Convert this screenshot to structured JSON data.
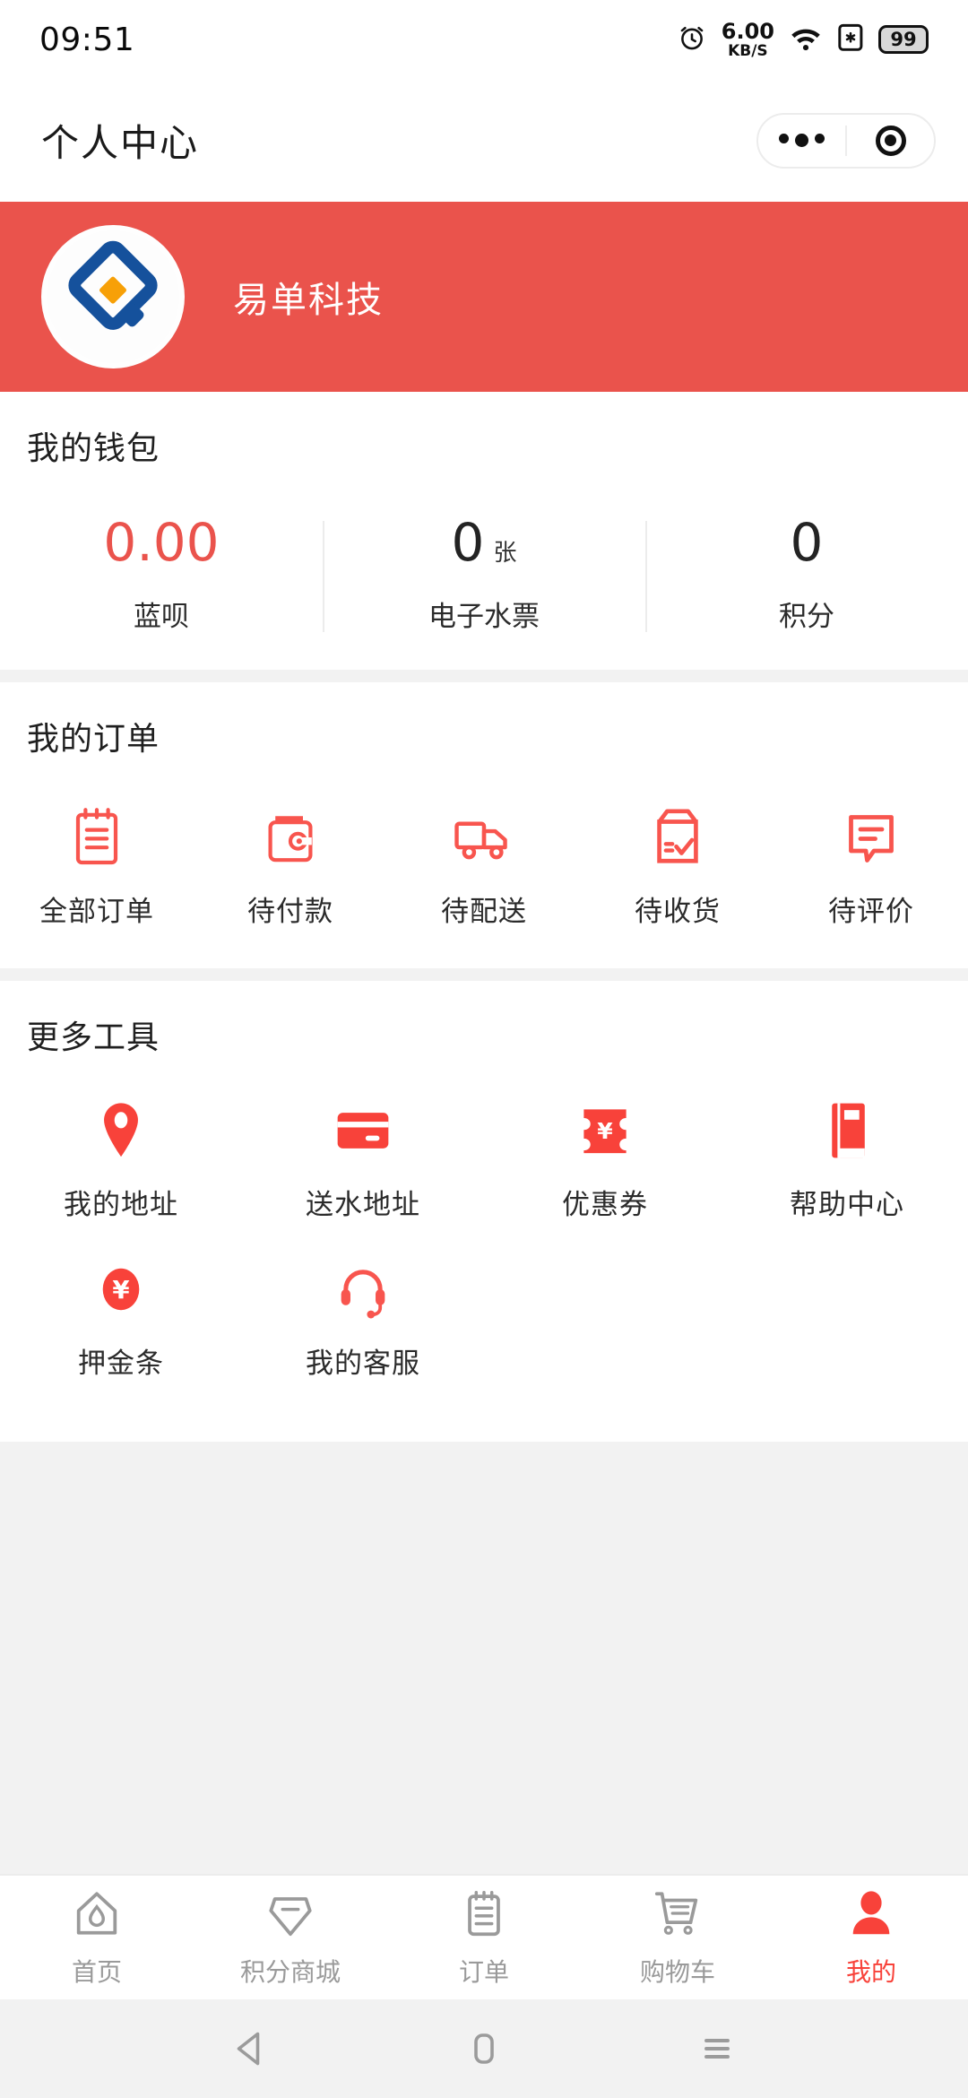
{
  "statusbar": {
    "time": "09:51",
    "net_speed_value": "6.00",
    "net_speed_unit": "KB/S",
    "battery": "99",
    "icons": [
      "alarm-icon",
      "wifi-icon",
      "sim-card-icon",
      "battery-icon"
    ]
  },
  "navbar": {
    "title": "个人中心",
    "capsule_menu_icon": "more-dots-icon",
    "capsule_close_icon": "target-circle-icon"
  },
  "profile": {
    "name": "易单科技",
    "avatar_icon": "company-logo-icon",
    "header_color": "#ea534c"
  },
  "wallet": {
    "title": "我的钱包",
    "items": [
      {
        "value": "0.00",
        "unit": "",
        "label": "蓝呗",
        "color": "#ea534c"
      },
      {
        "value": "0",
        "unit": "张",
        "label": "电子水票",
        "color": "#232323"
      },
      {
        "value": "0",
        "unit": "",
        "label": "积分",
        "color": "#232323"
      }
    ]
  },
  "orders": {
    "title": "我的订单",
    "items": [
      {
        "label": "全部订单",
        "icon": "clipboard-list-icon"
      },
      {
        "label": "待付款",
        "icon": "wallet-icon"
      },
      {
        "label": "待配送",
        "icon": "delivery-truck-icon"
      },
      {
        "label": "待收货",
        "icon": "package-check-icon"
      },
      {
        "label": "待评价",
        "icon": "comment-bubble-icon"
      }
    ]
  },
  "tools": {
    "title": "更多工具",
    "items": [
      {
        "label": "我的地址",
        "icon": "map-pin-icon"
      },
      {
        "label": "送水地址",
        "icon": "credit-card-icon"
      },
      {
        "label": "优惠券",
        "icon": "coupon-yen-icon"
      },
      {
        "label": "帮助中心",
        "icon": "book-icon"
      },
      {
        "label": "押金条",
        "icon": "yen-circle-icon"
      },
      {
        "label": "我的客服",
        "icon": "headset-icon"
      }
    ]
  },
  "tabbar": {
    "active_color": "#f8423a",
    "inactive_color": "#9a9a9a",
    "items": [
      {
        "label": "首页",
        "icon": "home-water-icon",
        "active": false
      },
      {
        "label": "积分商城",
        "icon": "points-mall-icon",
        "active": false
      },
      {
        "label": "订单",
        "icon": "order-list-icon",
        "active": false
      },
      {
        "label": "购物车",
        "icon": "shopping-cart-icon",
        "active": false
      },
      {
        "label": "我的",
        "icon": "user-profile-icon",
        "active": true
      }
    ]
  },
  "androidnav": {
    "back_icon": "back-triangle-icon",
    "home_icon": "home-rect-icon",
    "recents_icon": "recents-menu-icon"
  }
}
